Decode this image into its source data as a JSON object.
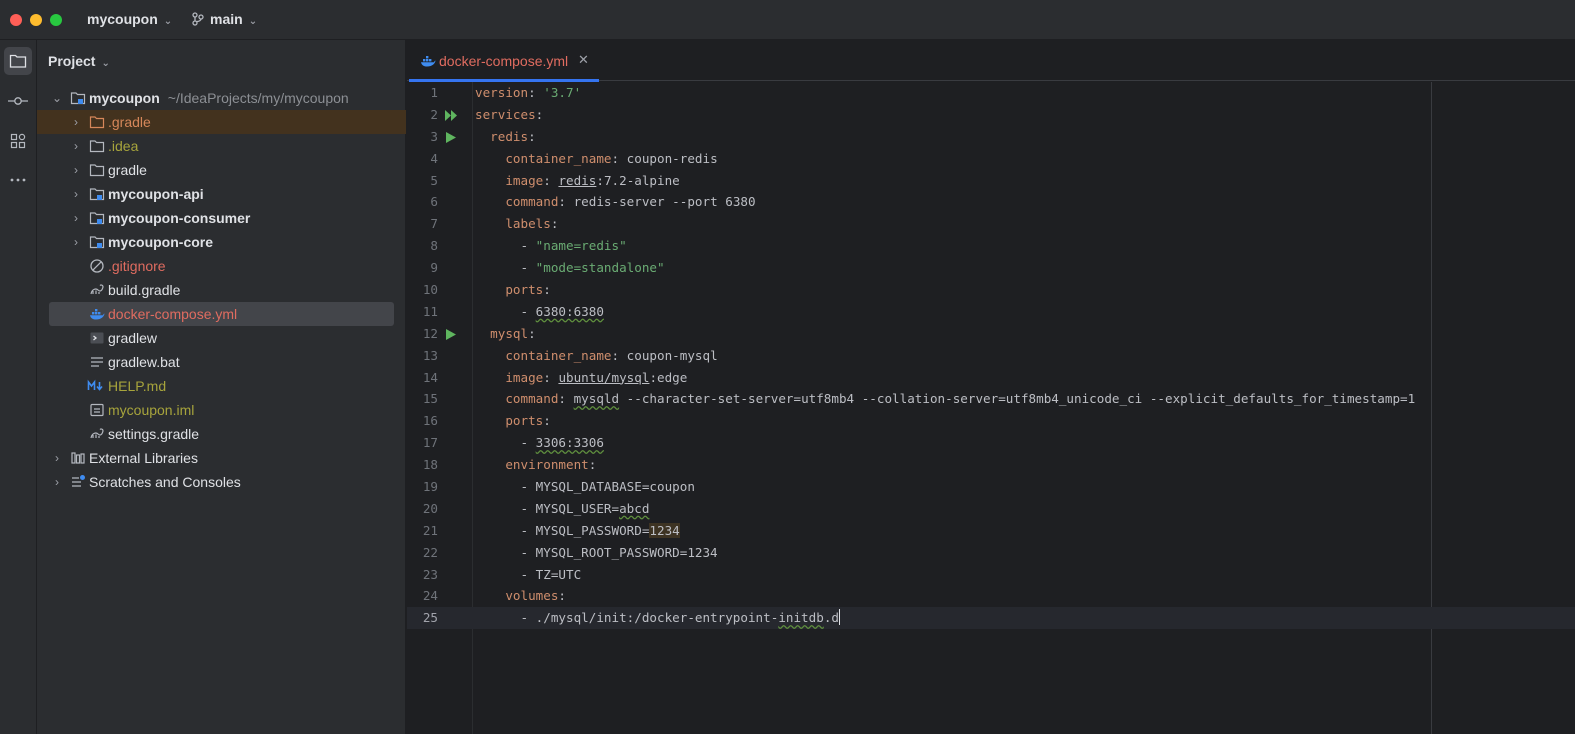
{
  "titlebar": {
    "project": "mycoupon",
    "branch": "main"
  },
  "toolstrip": {
    "icons": [
      "folder-icon",
      "commit-icon",
      "structure-icon",
      "more-icon"
    ]
  },
  "project_panel": {
    "header": "Project",
    "root": {
      "name": "mycoupon",
      "path": "~/IdeaProjects/my/mycoupon"
    },
    "items": [
      {
        "label": ".gradle",
        "icon": "folder-icon"
      },
      {
        "label": ".idea",
        "icon": "folder-icon"
      },
      {
        "label": "gradle",
        "icon": "folder-icon"
      },
      {
        "label": "mycoupon-api",
        "icon": "module-folder-icon"
      },
      {
        "label": "mycoupon-consumer",
        "icon": "module-folder-icon"
      },
      {
        "label": "mycoupon-core",
        "icon": "module-folder-icon"
      },
      {
        "label": ".gitignore",
        "icon": "ignore-icon"
      },
      {
        "label": "build.gradle",
        "icon": "gradle-icon"
      },
      {
        "label": "docker-compose.yml",
        "icon": "docker-icon"
      },
      {
        "label": "gradlew",
        "icon": "terminal-icon"
      },
      {
        "label": "gradlew.bat",
        "icon": "text-file-icon"
      },
      {
        "label": "HELP.md",
        "icon": "markdown-icon"
      },
      {
        "label": "mycoupon.iml",
        "icon": "iml-file-icon"
      },
      {
        "label": "settings.gradle",
        "icon": "gradle-icon"
      }
    ],
    "external_libraries": "External Libraries",
    "scratches": "Scratches and Consoles"
  },
  "editor": {
    "tab": {
      "label": "docker-compose.yml"
    },
    "line_numbers": [
      "1",
      "2",
      "3",
      "4",
      "5",
      "6",
      "7",
      "8",
      "9",
      "10",
      "11",
      "12",
      "13",
      "14",
      "15",
      "16",
      "17",
      "18",
      "19",
      "20",
      "21",
      "22",
      "23",
      "24",
      "25"
    ],
    "lines": {
      "l1": {
        "key": "version",
        "val": "'3.7'"
      },
      "l2": {
        "key": "services"
      },
      "l3": {
        "key": "redis"
      },
      "l4": {
        "key": "container_name",
        "val": "coupon-redis"
      },
      "l5": {
        "key": "image",
        "val_a": "redis",
        "val_b": ":7.2-alpine"
      },
      "l6": {
        "key": "command",
        "val": "redis-server --port 6380"
      },
      "l7": {
        "key": "labels"
      },
      "l8": {
        "val": "\"name=redis\""
      },
      "l9": {
        "val": "\"mode=standalone\""
      },
      "l10": {
        "key": "ports"
      },
      "l11": {
        "val": "6380:6380"
      },
      "l12": {
        "key": "mysql"
      },
      "l13": {
        "key": "container_name",
        "val": "coupon-mysql"
      },
      "l14": {
        "key": "image",
        "val_a": "ubuntu/mysql",
        "val_b": ":edge"
      },
      "l15": {
        "key": "command",
        "val_a": "mysqld",
        "val_b": " --character-set-server=utf8mb4 --collation-server=utf8mb4_unicode_ci --explicit_defaults_for_timestamp=1"
      },
      "l16": {
        "key": "ports"
      },
      "l17": {
        "val": "3306:3306"
      },
      "l18": {
        "key": "environment"
      },
      "l19": {
        "val": "MYSQL_DATABASE=coupon"
      },
      "l20": {
        "val_a": "MYSQL_USER=",
        "val_b": "abcd"
      },
      "l21": {
        "val_a": "MYSQL_PASSWORD=",
        "val_b": "1234"
      },
      "l22": {
        "val": "MYSQL_ROOT_PASSWORD=1234"
      },
      "l23": {
        "val": "TZ=UTC"
      },
      "l24": {
        "key": "volumes"
      },
      "l25": {
        "val_a": "./mysql/init:/docker-entrypoint-",
        "val_b": "initdb",
        "val_c": ".d"
      }
    }
  },
  "colors": {
    "accent": "#3574f0",
    "key": "#cf8e6d",
    "string": "#6aab73",
    "run": "#5fb55f",
    "docker": "#3f8cf0"
  }
}
